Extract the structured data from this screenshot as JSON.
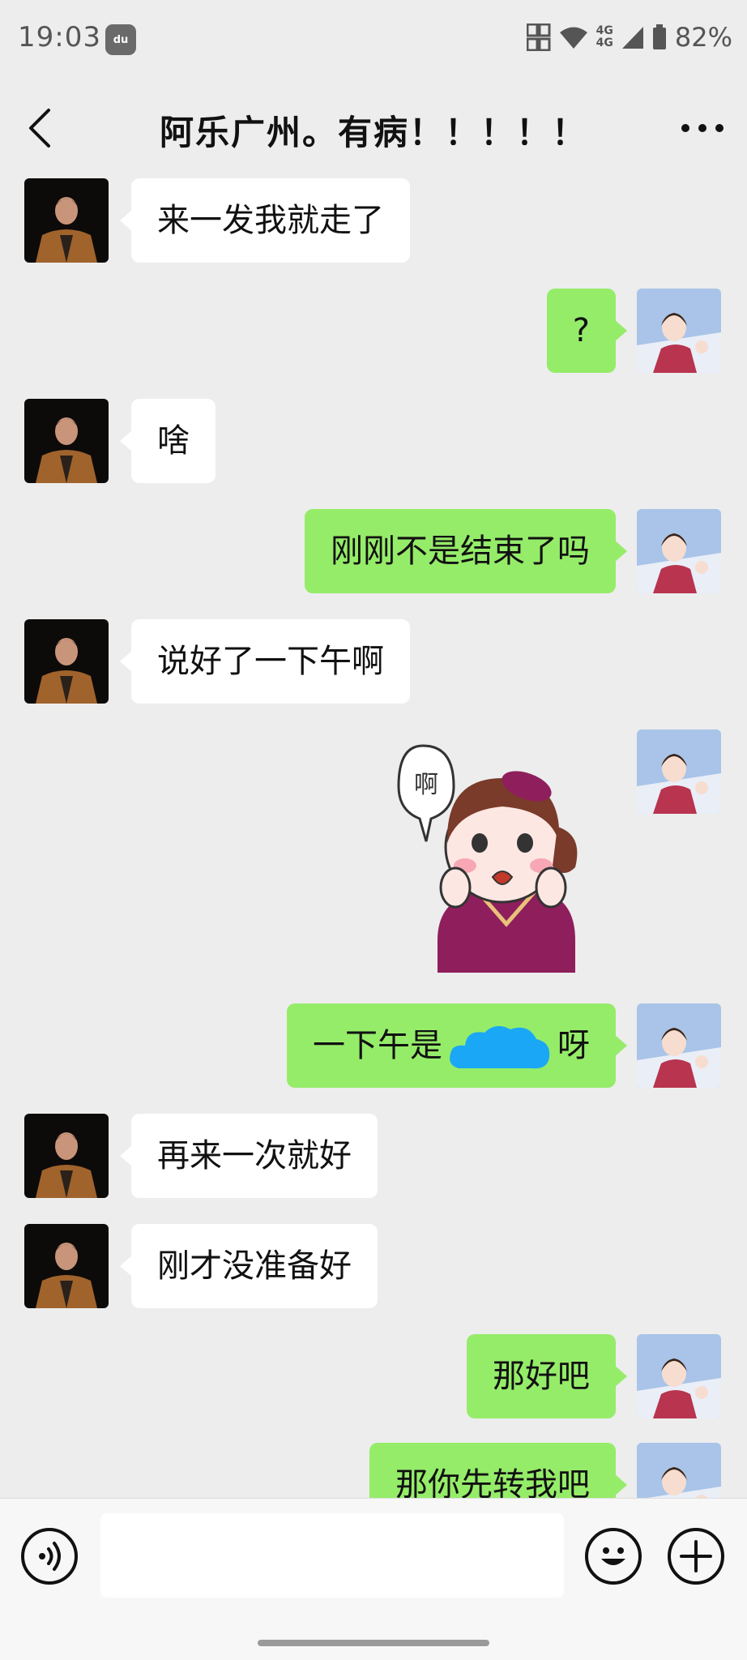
{
  "status_bar": {
    "time": "19:03",
    "badge": "du",
    "network_top": "4G",
    "network_bottom": "4G",
    "battery": "82%"
  },
  "header": {
    "title": "阿乐广州。有病！！！！！"
  },
  "messages": [
    {
      "side": "in",
      "text": "来一发我就走了"
    },
    {
      "side": "out",
      "text": "?"
    },
    {
      "side": "in",
      "text": "啥"
    },
    {
      "side": "out",
      "text": "刚刚不是结束了吗"
    },
    {
      "side": "in",
      "text": "说好了一下午啊"
    },
    {
      "side": "out",
      "type": "sticker",
      "sticker_text": "啊"
    },
    {
      "side": "out",
      "text_before": "一下午是",
      "text_after": "呀"
    },
    {
      "side": "in",
      "text": "再来一次就好"
    },
    {
      "side": "in",
      "text": "刚才没准备好"
    },
    {
      "side": "out",
      "text": "那好吧"
    },
    {
      "side": "out",
      "text": "那你先转我吧"
    }
  ],
  "input": {
    "value": ""
  },
  "icons": {
    "back": "chevron-left-icon",
    "more": "more-dots-icon",
    "voice": "voice-icon",
    "emoji": "emoji-icon",
    "plus": "plus-icon"
  },
  "colors": {
    "outgoing_bubble": "#95ec69",
    "incoming_bubble": "#ffffff",
    "background": "#ededed"
  }
}
